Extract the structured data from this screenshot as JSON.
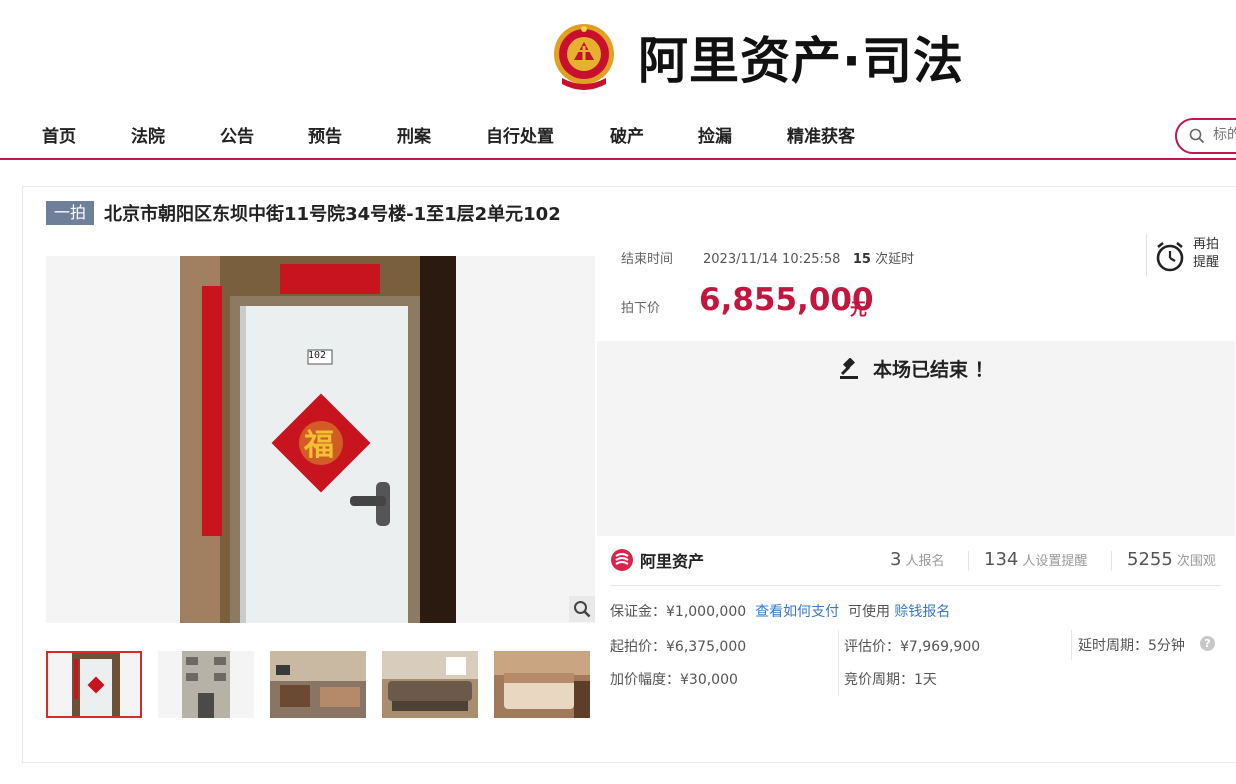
{
  "header": {
    "brand_title": "阿里资产·司法",
    "nav": [
      "首页",
      "法院",
      "公告",
      "预告",
      "刑案",
      "自行处置",
      "破产",
      "捡漏",
      "精准获客"
    ],
    "search_placeholder": "标的"
  },
  "auction": {
    "badge": "一拍",
    "title": "北京市朝阳区东坝中街11号院34号楼-1至1层2单元102",
    "end_label": "结束时间",
    "end_time": "2023/11/14 10:25:58",
    "delay_count": "15",
    "delay_suffix": "次延时",
    "remind_label": "再拍提醒",
    "price_label": "拍下价",
    "price": "6,855,000",
    "price_unit": "元",
    "status_text": "本场已结束 ！"
  },
  "gallery": {
    "door_number": "102",
    "fu_char": "福",
    "thumb_count": 5,
    "active_thumb": 0
  },
  "stats": {
    "logo_name": "阿里资产",
    "registrants": "3",
    "registrants_label": "人报名",
    "reminders": "134",
    "reminders_label": "人设置提醒",
    "views": "5255",
    "views_label": "次围观"
  },
  "details": {
    "deposit": "保证金：¥1,000,000",
    "how_to_pay": "查看如何支付",
    "can_use": "可使用",
    "credit_signup": "赊钱报名",
    "start_price": "起拍价：¥6,375,000",
    "eval_price": "评估价：¥7,969,900",
    "delay_period": "延时周期：5分钟",
    "increment": "加价幅度：¥30,000",
    "bid_period": "竞价周期：1天",
    "help_icon": "?"
  },
  "colors": {
    "brand": "#c3164f",
    "price": "#c3163e",
    "link": "#3a78c3",
    "badge": "#6e7f99"
  }
}
